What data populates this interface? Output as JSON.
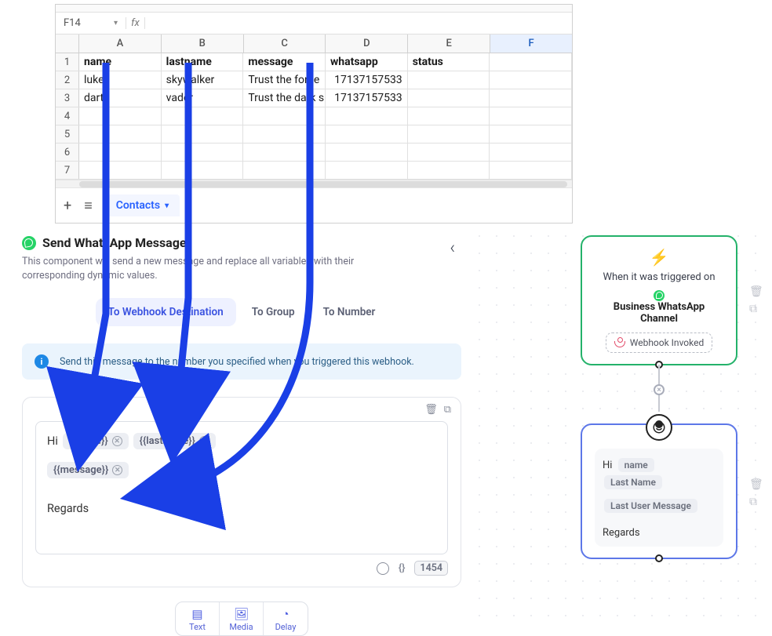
{
  "spreadsheet": {
    "cell_ref": "F14",
    "fx_label": "fx",
    "columns": [
      "A",
      "B",
      "C",
      "D",
      "E",
      "F"
    ],
    "header_row": [
      "name",
      "lastname",
      "message",
      "whatsapp",
      "status",
      ""
    ],
    "rows": [
      [
        "luke",
        "skywalker",
        "Trust the force",
        "17137157533",
        "",
        ""
      ],
      [
        "darth",
        "vader",
        "Trust the dark s",
        "17137157533",
        "",
        ""
      ]
    ],
    "empty_row_numbers": [
      4,
      5,
      6,
      7
    ],
    "sheet_tab": "Contacts"
  },
  "editor": {
    "title": "Send WhatsApp Message",
    "desc": "This component will send a new message and replace all variables with their corresponding dynamic values.",
    "tabs": {
      "webhook": "To Webhook Destination",
      "group": "To Group",
      "number": "To Number"
    },
    "info": "Send this message to the number you specified when you triggered this webhook.",
    "greeting": "Hi",
    "chips": {
      "name": "{{name}}",
      "lastname": "{{lastname}}",
      "message": "{{message}}"
    },
    "regards": "Regards",
    "char_count": "1454",
    "actions": {
      "text": "Text",
      "media": "Media",
      "delay": "Delay"
    }
  },
  "flow": {
    "trigger": {
      "line1": "When it was triggered on",
      "line2": "Business WhatsApp Channel",
      "webhook": "Webhook Invoked"
    },
    "message": {
      "hi": "Hi",
      "pill_name": "name",
      "pill_last": "Last Name",
      "pill_msg": "Last User Message",
      "regards": "Regards"
    }
  }
}
